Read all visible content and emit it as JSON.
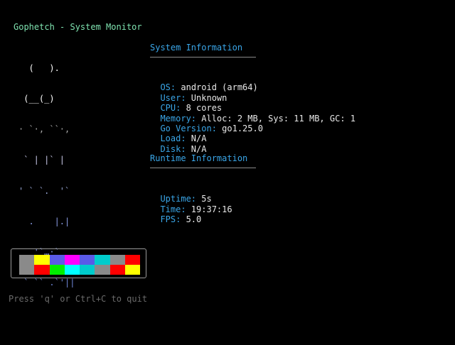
{
  "app": {
    "title": "Gophetch - System Monitor"
  },
  "ascii_art": {
    "lines": [
      {
        "text": "  (   ).",
        "color": "#ffffff"
      },
      {
        "text": " (__(_)",
        "color": "#ffffff"
      },
      {
        "text": "· `·, ``·,",
        "color": "#a9a9a9"
      },
      {
        "text": " ` | |` |",
        "color": "#c8c8e8"
      },
      {
        "text": "' ` `.  '`",
        "color": "#9aa8d8"
      },
      {
        "text": "  .    |.|",
        "color": "#8c9ee8"
      },
      {
        "text": "   '`…·`",
        "color": "#8094e0"
      },
      {
        "text": " ` `` .`'||",
        "color": "#6f86d8"
      }
    ]
  },
  "system_info": {
    "heading": "System Information",
    "rows": [
      {
        "key": "OS:",
        "value": " android (arm64)"
      },
      {
        "key": "User:",
        "value": " Unknown"
      },
      {
        "key": "CPU:",
        "value": " 8 cores"
      },
      {
        "key": "Memory:",
        "value": " Alloc: 2 MB, Sys: 11 MB, GC: 1"
      },
      {
        "key": "Go Version:",
        "value": " go1.25.0"
      },
      {
        "key": "Load:",
        "value": " N/A"
      },
      {
        "key": "Disk:",
        "value": " N/A"
      }
    ]
  },
  "runtime_info": {
    "heading": "Runtime Information",
    "rows": [
      {
        "key": "Uptime:",
        "value": " 5s"
      },
      {
        "key": "Time:",
        "value": " 19:37:16"
      },
      {
        "key": "FPS:",
        "value": " 5.0"
      }
    ]
  },
  "palette": {
    "top": [
      "#8a8a8a",
      "#ffff00",
      "#5a5ae8",
      "#ff00ff",
      "#5a5ae8",
      "#00cccc",
      "#8a8a8a",
      "#ff0000"
    ],
    "bottom": [
      "#8a8a8a",
      "#ff0000",
      "#00ee00",
      "#00ffff",
      "#00cccc",
      "#8a8a8a",
      "#ff0000",
      "#ffff00"
    ]
  },
  "footer": {
    "hint": "Press 'q' or Ctrl+C to quit"
  }
}
